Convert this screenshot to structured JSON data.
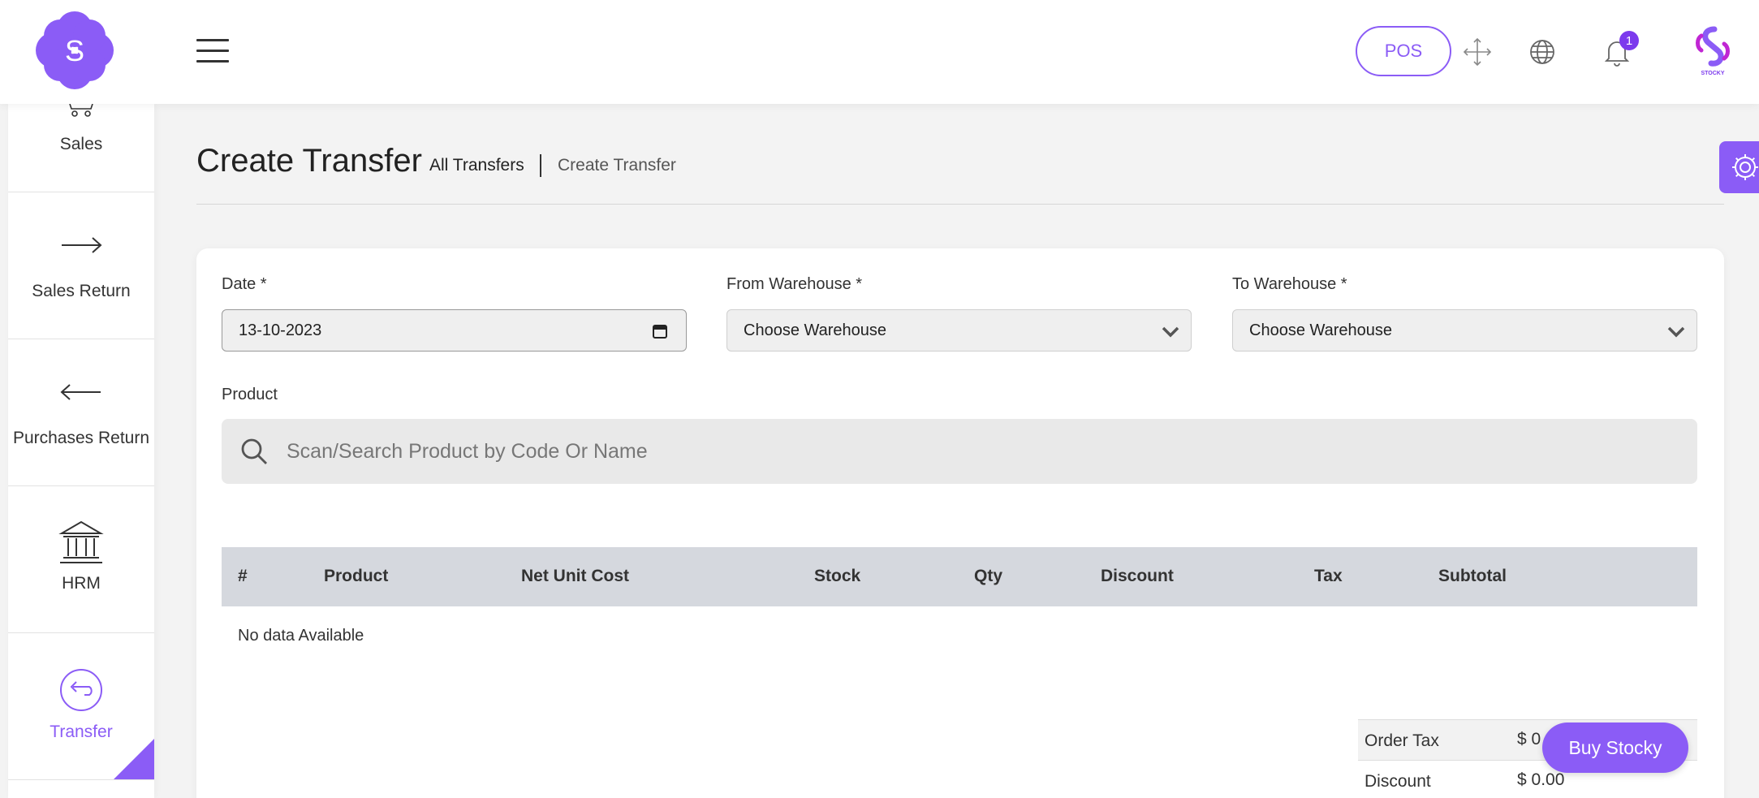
{
  "header": {
    "logo_letter": "S",
    "pos_label": "POS",
    "notification_count": "1",
    "brand_caption": "STOCKY",
    "accent_color": "#8b5cf6"
  },
  "sidebar": {
    "items": [
      {
        "label": "Sales",
        "icon": "cart-icon"
      },
      {
        "label": "Sales Return",
        "icon": "arrow-right-icon"
      },
      {
        "label": "Purchases Return",
        "icon": "arrow-left-icon"
      },
      {
        "label": "HRM",
        "icon": "bank-icon"
      },
      {
        "label": "Transfer",
        "icon": "transfer-icon",
        "active": true
      }
    ]
  },
  "page": {
    "title": "Create Transfer",
    "breadcrumb_all": "All Transfers",
    "breadcrumb_current": "Create Transfer"
  },
  "form": {
    "date_label": "Date *",
    "date_value": "13-10-2023",
    "from_label": "From Warehouse *",
    "from_value": "Choose Warehouse",
    "to_label": "To Warehouse *",
    "to_value": "Choose Warehouse",
    "product_label": "Product",
    "search_placeholder": "Scan/Search Product by Code Or Name"
  },
  "table": {
    "columns": [
      "#",
      "Product",
      "Net Unit Cost",
      "Stock",
      "Qty",
      "Discount",
      "Tax",
      "Subtotal"
    ],
    "empty_text": "No data Available"
  },
  "summary": {
    "rows": [
      {
        "label": "Order Tax",
        "value": "$ 0"
      },
      {
        "label": "Discount",
        "value": "$ 0.00"
      }
    ]
  },
  "buy_label": "Buy Stocky"
}
